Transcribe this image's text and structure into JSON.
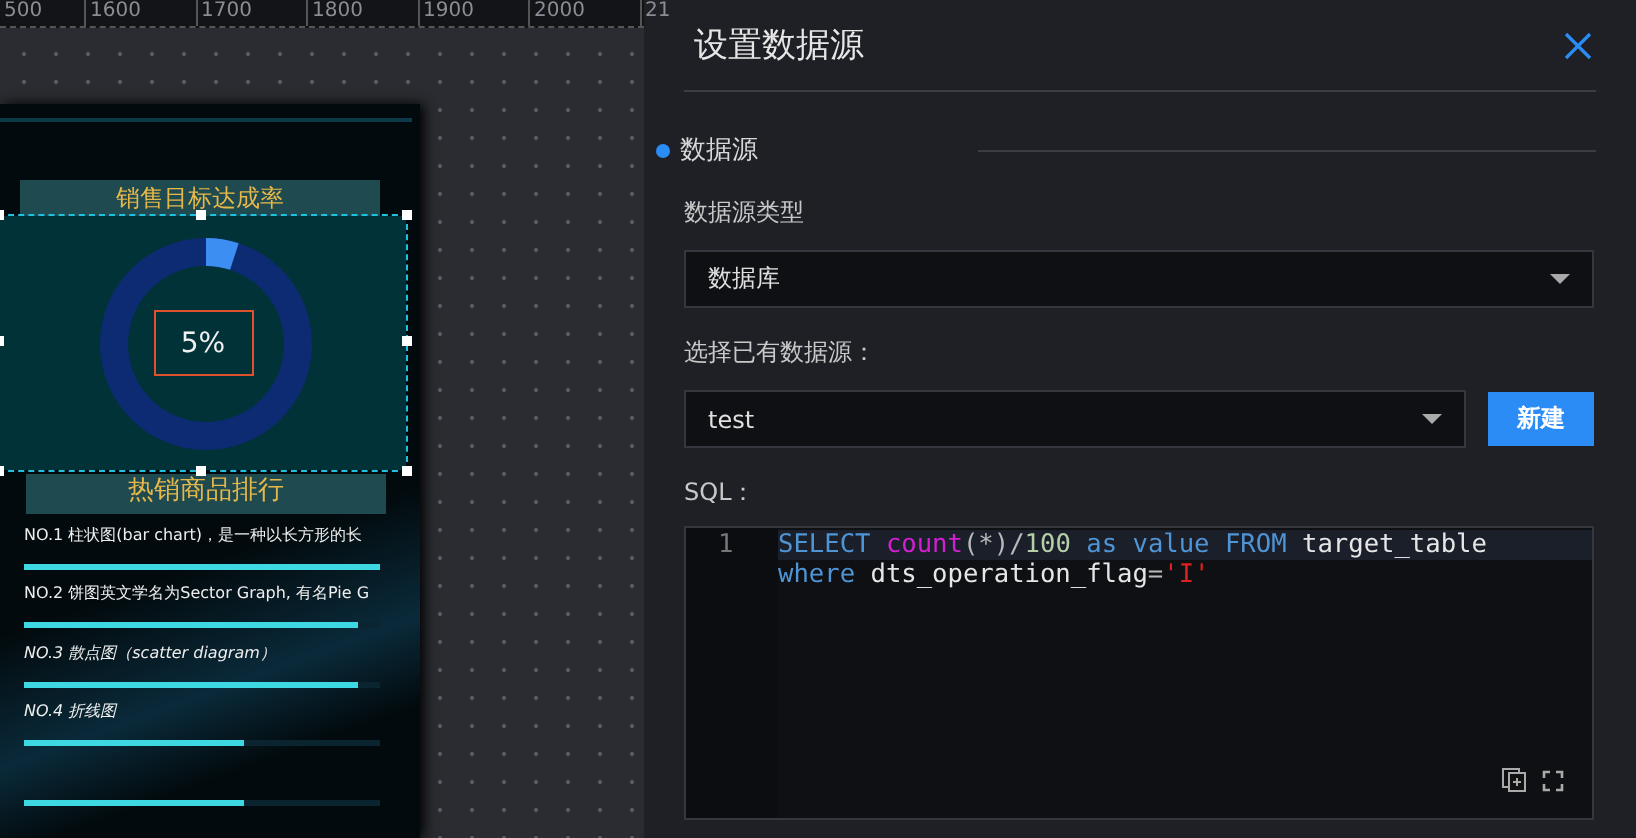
{
  "ruler": {
    "ticks": [
      "500",
      "1600",
      "1700",
      "1800",
      "1900",
      "2000",
      "21"
    ]
  },
  "dashboard": {
    "gauge_title": "销售目标达成率",
    "gauge": {
      "level": 0.05,
      "reading": "5%",
      "selected": true
    },
    "ranking_title": "热销商品排行",
    "ranking": [
      {
        "text": "NO.1  柱状图(bar chart)，是一种以长方形的长",
        "italic": false,
        "level": 1
      },
      {
        "text": "NO.2  饼图英文学名为Sector Graph, 有名Pie G",
        "italic": false,
        "level": 0.94
      },
      {
        "text": "NO.3  散点图（scatter diagram）",
        "italic": true,
        "level": 0.94
      },
      {
        "text": "NO.4  折线图",
        "italic": true,
        "level": 0.62
      },
      {
        "level": 0.62
      }
    ]
  },
  "panel": {
    "title": "设置数据源",
    "section": "数据源",
    "type_label": "数据源类型",
    "type_value": "数据库",
    "source_label": "选择已有数据源：",
    "source_value": "test",
    "new_button": "新建",
    "sql_label": "SQL：",
    "sql": {
      "line_numbers": [
        "1"
      ],
      "lines": [
        [
          {
            "text": "SELECT ",
            "kind": "keyword"
          },
          {
            "text": "count",
            "kind": "function"
          },
          {
            "text": "(*)/",
            "kind": "punct"
          },
          {
            "text": "100",
            "kind": "number"
          },
          {
            "text": " as value FROM ",
            "kind": "keyword"
          },
          {
            "text": "target_table",
            "kind": "ident"
          }
        ],
        [
          {
            "text": "where ",
            "kind": "keyword"
          },
          {
            "text": "dts_operation_flag",
            "kind": "ident"
          },
          {
            "text": "=",
            "kind": "punct"
          },
          {
            "text": "'I'",
            "kind": "string"
          }
        ]
      ]
    }
  }
}
